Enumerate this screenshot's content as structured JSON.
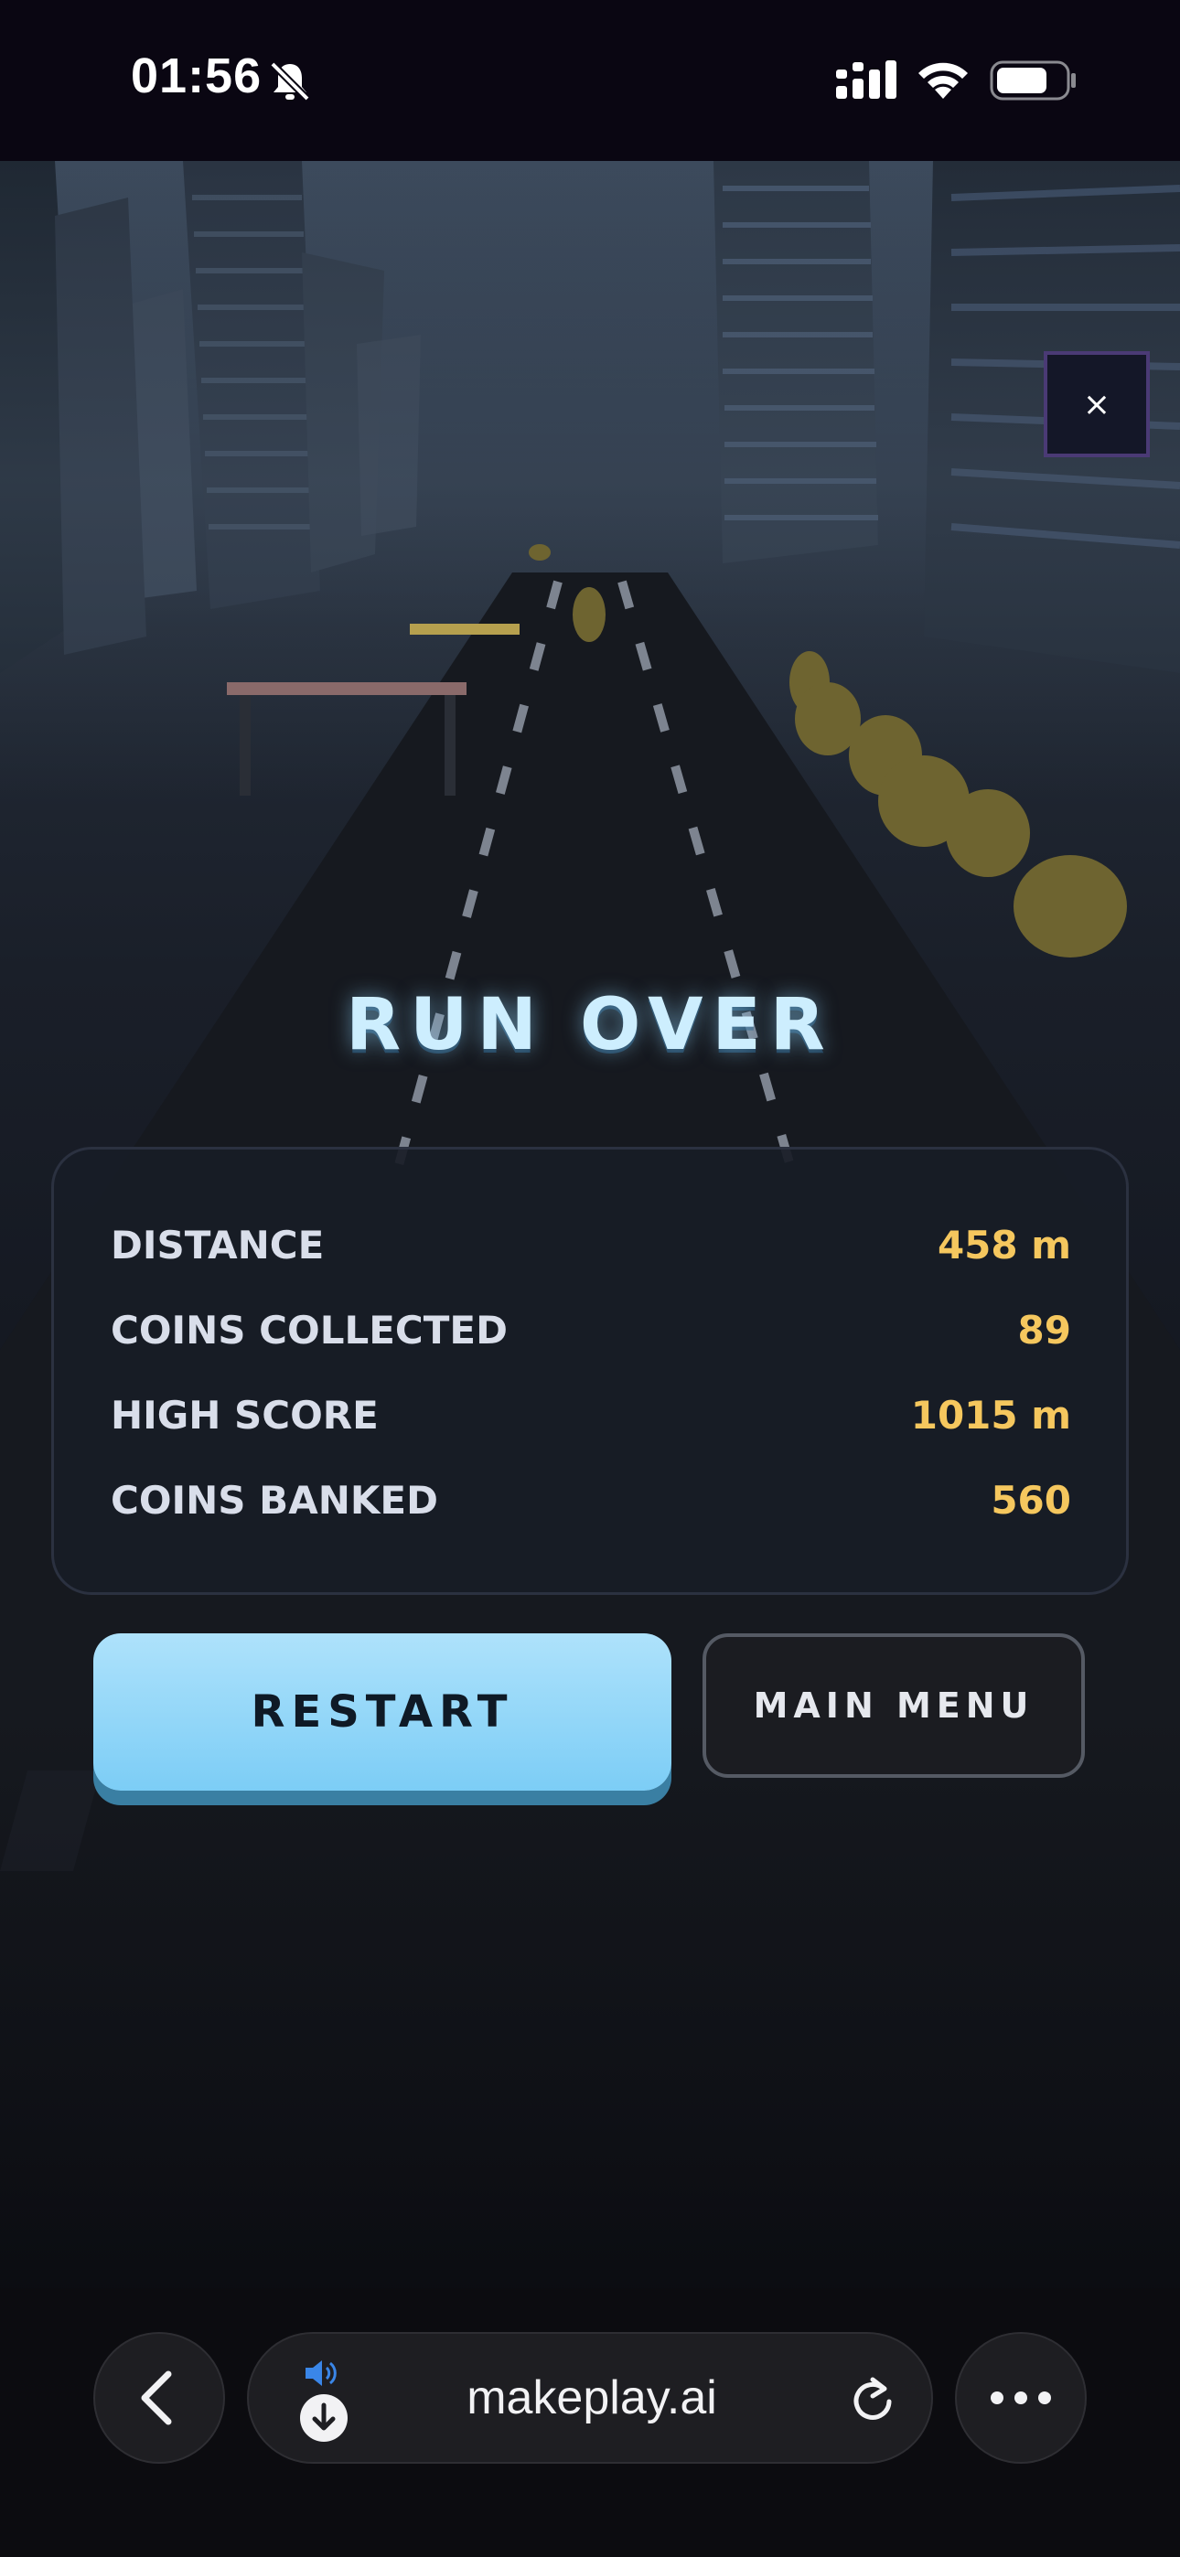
{
  "status_bar": {
    "time": "01:56",
    "icons": [
      "bell-muted-icon",
      "cellular-signal-icon",
      "wifi-icon",
      "battery-icon"
    ]
  },
  "game": {
    "close_label": "×",
    "title": "RUN OVER",
    "stats": [
      {
        "label": "DISTANCE",
        "value": "458 m"
      },
      {
        "label": "COINS COLLECTED",
        "value": "89"
      },
      {
        "label": "HIGH SCORE",
        "value": "1015 m"
      },
      {
        "label": "COINS BANKED",
        "value": "560"
      }
    ],
    "restart_label": "RESTART",
    "main_menu_label": "MAIN MENU"
  },
  "browser": {
    "url": "makeplay.ai",
    "icons": [
      "back-chevron-icon",
      "speaker-icon",
      "download-icon",
      "reload-icon",
      "more-icon"
    ]
  },
  "colors": {
    "accent_blue": "#7ccdf6",
    "stat_value_gold": "#f5c75e",
    "title_glow": "#cdeefe"
  }
}
